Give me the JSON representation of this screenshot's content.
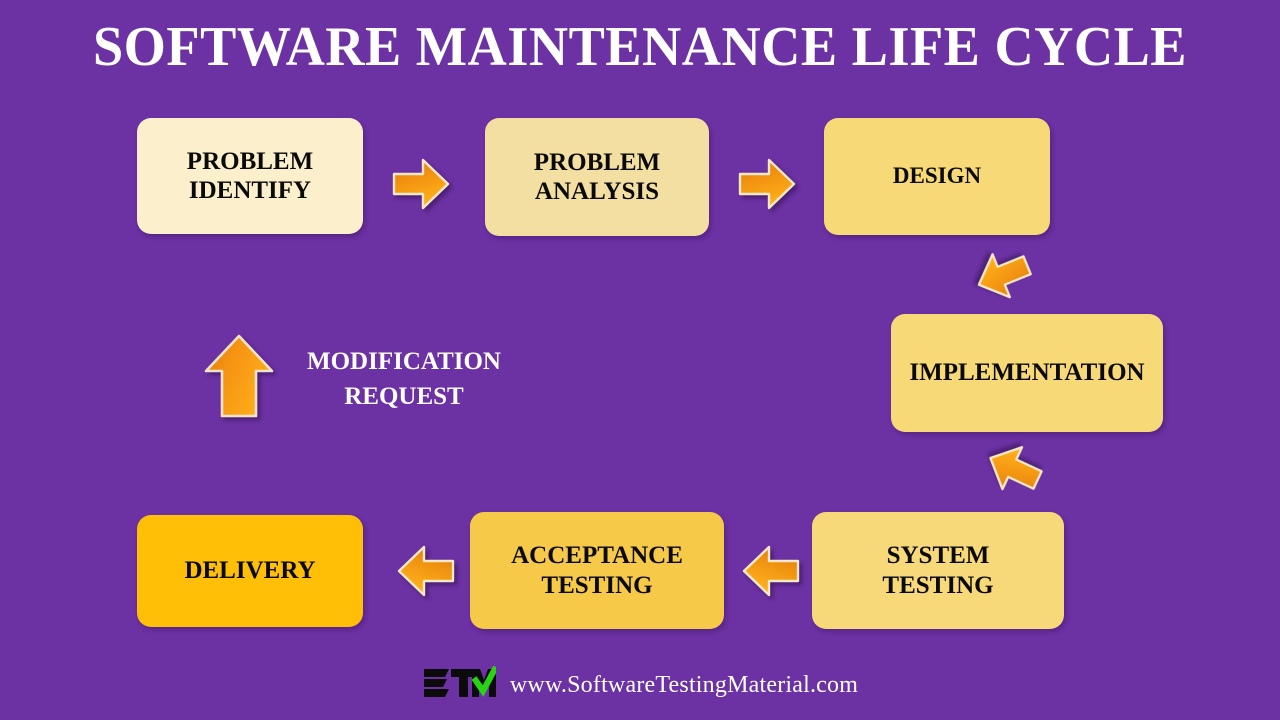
{
  "page": {
    "title": "SOFTWARE MAINTENANCE LIFE CYCLE",
    "background_color": "#6C31A3",
    "title_color": "#FFFFFF"
  },
  "diagram": {
    "type": "flow-cycle",
    "boxes": [
      {
        "id": "problem-identify",
        "label": "PROBLEM\nIDENTIFY",
        "fill": "#FCEFCB",
        "text_color": "#0A0A0A"
      },
      {
        "id": "problem-analysis",
        "label": "PROBLEM\nANALYSIS",
        "fill": "#F3DFA2",
        "text_color": "#0A0A0A"
      },
      {
        "id": "design",
        "label": "DESIGN",
        "fill": "#F8D978",
        "text_color": "#0A0A0A"
      },
      {
        "id": "implementation",
        "label": "IMPLEMENTATION",
        "fill": "#F8D978",
        "text_color": "#0A0A0A"
      },
      {
        "id": "system-testing",
        "label": "SYSTEM\nTESTING",
        "fill": "#F8D979",
        "text_color": "#0A0A0A"
      },
      {
        "id": "acceptance-testing",
        "label": "ACCEPTANCE\nTESTING",
        "fill": "#F7C948",
        "text_color": "#0A0A0A"
      },
      {
        "id": "delivery",
        "label": "DELIVERY",
        "fill": "#FFBF06",
        "text_color": "#0A0A0A"
      }
    ],
    "annotation": {
      "label": "MODIFICATION\nREQUEST",
      "text_color": "#FFFFFF"
    },
    "arrow_colors": {
      "light": "#FFA216",
      "dark": "#DD7D0E",
      "outline": "#F7E9C8"
    }
  },
  "footer": {
    "logo_text": "STM",
    "logo_color": "#0B0B0B",
    "check_color": "#27D413",
    "url": "www.SoftwareTestingMaterial.com",
    "url_color": "#FFFFFF"
  }
}
